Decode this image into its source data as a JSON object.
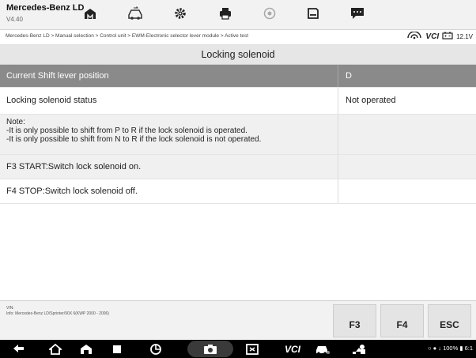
{
  "app": {
    "title": "Mercedes-Benz LD",
    "version": "V4.40"
  },
  "toolbar": {
    "icons": [
      "home-icon",
      "vehicle-swap-icon",
      "settings-icon",
      "print-icon",
      "help-icon",
      "save-icon",
      "message-icon"
    ]
  },
  "breadcrumb": "Mercedes-Benz LD > Manual selection > Control unit > EWM-Electronic selector lever module > Active test",
  "vci": {
    "label": "VCI",
    "voltage": "12.1V"
  },
  "page_title": "Locking solenoid",
  "table": {
    "rows": [
      {
        "label": "Current Shift lever position",
        "value": "D"
      },
      {
        "label": "Locking solenoid status",
        "value": "Not operated"
      }
    ],
    "note": {
      "title": "Note:",
      "line1": "-It is only possible to shift from P to R if the lock solenoid is operated.",
      "line2": "-It is only possible to shift from N to R if the lock solenoid is not operated."
    },
    "f3_row": "F3 START:Switch lock solenoid on.",
    "f4_row": "F4 STOP:Switch lock solenoid off."
  },
  "footer": {
    "vin_label": "VIN:",
    "info_label": "Info: Mercedes-Benz LD/Sprinter/90X 6(KWP 2000 - 2006)",
    "buttons": {
      "f3": "F3",
      "f4": "F4",
      "esc": "ESC"
    }
  },
  "navbar": {
    "vci_label": "VCI"
  },
  "status": {
    "text": "○ ● ↓ 100% ▮ 6:1"
  }
}
